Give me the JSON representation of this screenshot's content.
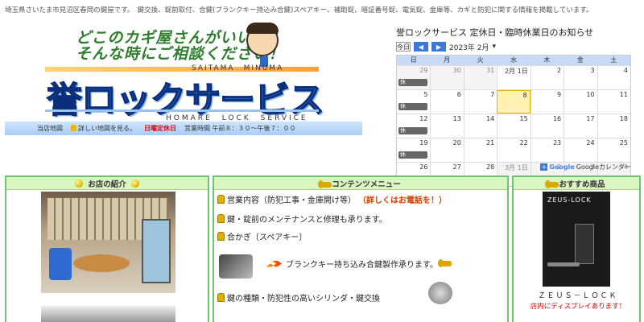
{
  "header": {
    "tagline": "埼玉県さいたま市見沼区春岡の鍵屋です。　鍵交換、錠前取付、合鍵(ブランクキー持込み合鍵)スペアキー、補助錠、暗証番号錠、電気錠、金庫等、カギと防犯に関する情報を掲載しています。"
  },
  "logo": {
    "catch1": "どこのカギ屋さんがいいの？",
    "catch2": "そんな時にご相談ください！",
    "sub_top": "SAITAMA　MINUMA",
    "name": "誉ロックサービス",
    "sub_bottom": "HOMARE　LOCK　SERVICE"
  },
  "infobar": {
    "map_label": "当店地図",
    "map_link": "詳しい地図を見る。",
    "holiday": "日曜定休日",
    "hours": "営業時間 午前８：３０〜午後７：００"
  },
  "calendar": {
    "title": "誉ロックサービス 定休日・臨時休業日のお知らせ",
    "today_btn": "今日",
    "prev": "◀",
    "next": "▶",
    "month": "2023年 2月",
    "weekdays": [
      "日",
      "月",
      "火",
      "水",
      "木",
      "金",
      "土"
    ],
    "weeks": [
      {
        "days": [
          "29",
          "30",
          "31",
          "2月 1日",
          "2",
          "3",
          "4"
        ],
        "gray": [
          true,
          true,
          true,
          false,
          false,
          false,
          false
        ],
        "event_on_first": true
      },
      {
        "days": [
          "5",
          "6",
          "7",
          "8",
          "9",
          "10",
          "11"
        ],
        "gray": [
          false,
          false,
          false,
          false,
          false,
          false,
          false
        ],
        "event_on_first": true,
        "today": 3
      },
      {
        "days": [
          "12",
          "13",
          "14",
          "15",
          "16",
          "17",
          "18"
        ],
        "gray": [
          false,
          false,
          false,
          false,
          false,
          false,
          false
        ],
        "event_on_first": true
      },
      {
        "days": [
          "19",
          "20",
          "21",
          "22",
          "23",
          "24",
          "25"
        ],
        "gray": [
          false,
          false,
          false,
          false,
          false,
          false,
          false
        ],
        "event_on_first": true
      },
      {
        "days": [
          "26",
          "27",
          "28",
          "3月 1日",
          "2",
          "3",
          "4"
        ],
        "gray": [
          false,
          false,
          false,
          true,
          true,
          true,
          true
        ],
        "event_on_first": true
      }
    ],
    "event_label": "休",
    "footer": "Googleカレンダー"
  },
  "shop": {
    "heading": "お店の紹介"
  },
  "menu": {
    "heading": "コンテンツメニュー",
    "item1": "営業内容（防犯工事・金庫開け等）",
    "item1_note": "（詳しくはお電話を！）",
    "item2": "鍵・錠前のメンテナンスと修理も承ります。",
    "item3": "合かぎ〔スペアキー〕",
    "item4": "ブランクキー持ち込み合鍵製作承ります。",
    "item5": "鍵の種類・防犯性の高いシリンダ・鍵交換"
  },
  "recommend": {
    "heading": "おすすめ商品",
    "brand": "ZEUS-LOCK",
    "name": "ＺＥＵＳ－ＬＯＣＫ",
    "note": "店内にディスプレイあります！"
  },
  "colors": {
    "accent_blue": "#1f68c9",
    "green_border": "#6fc26f",
    "red_text": "#dd0000"
  }
}
